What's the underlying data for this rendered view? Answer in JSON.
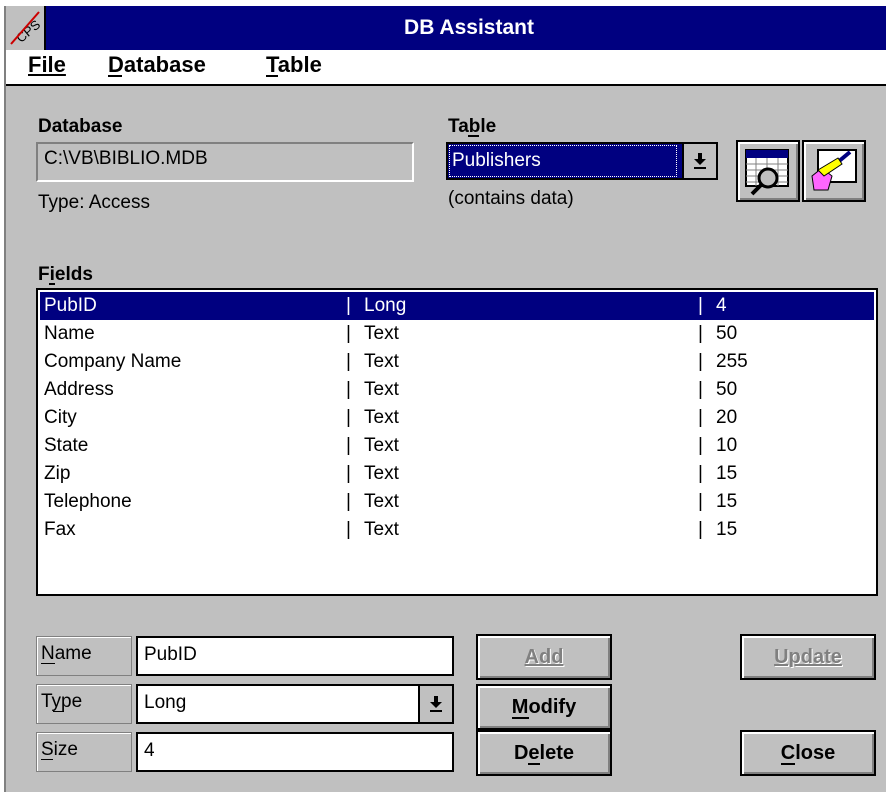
{
  "window": {
    "title": "DB Assistant",
    "sys_icon": "cps-system-menu-icon"
  },
  "menu": {
    "file": "File",
    "database": "Database",
    "table": "Table"
  },
  "database": {
    "heading": "Database",
    "path": "C:\\VB\\BIBLIO.MDB",
    "type_text": "Type: Access"
  },
  "table": {
    "heading": "Table",
    "selected": "Publishers",
    "note": "(contains data)"
  },
  "toolbar": {
    "view_icon": "view-table-icon",
    "edit_icon": "edit-table-icon"
  },
  "fields": {
    "heading": "Fields",
    "rows": [
      {
        "name": "PubID",
        "type": "Long",
        "size": "4"
      },
      {
        "name": "Name",
        "type": "Text",
        "size": "50"
      },
      {
        "name": "Company Name",
        "type": "Text",
        "size": "255"
      },
      {
        "name": "Address",
        "type": "Text",
        "size": "50"
      },
      {
        "name": "City",
        "type": "Text",
        "size": "20"
      },
      {
        "name": "State",
        "type": "Text",
        "size": "10"
      },
      {
        "name": "Zip",
        "type": "Text",
        "size": "15"
      },
      {
        "name": "Telephone",
        "type": "Text",
        "size": "15"
      },
      {
        "name": "Fax",
        "type": "Text",
        "size": "15"
      }
    ]
  },
  "editor": {
    "name_label": "Name",
    "name_value": "PubID",
    "type_label": "Type",
    "type_value": "Long",
    "size_label": "Size",
    "size_value": "4"
  },
  "buttons": {
    "add": "Add",
    "modify": "Modify",
    "delete": "Delete",
    "update": "Update",
    "close": "Close"
  },
  "colors": {
    "title_bar": "#000080",
    "face": "#c0c0c0",
    "selection": "#000080"
  }
}
